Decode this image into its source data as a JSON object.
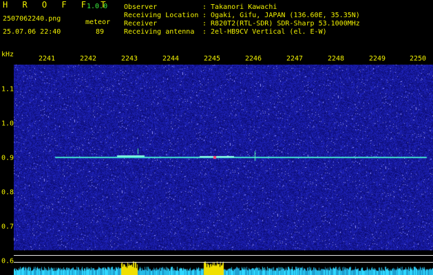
{
  "header": {
    "logo": "H R O F F T",
    "version": "1.0.0",
    "filename": "2507062240.png",
    "datetime": "25.07.06 22:40",
    "mode_label": "meteor",
    "count": "89",
    "fields": [
      {
        "label": "Observer",
        "value": ": Takanori Kawachi"
      },
      {
        "label": "Receiving Location",
        "value": ": Ogaki, Gifu, JAPAN (136.60E, 35.35N)"
      },
      {
        "label": "Receiver",
        "value": ": R820T2(RTL-SDR) SDR-Sharp 53.1000MHz"
      },
      {
        "label": "Receiving antenna",
        "value": ": 2el-HB9CV Vertical (el. E-W)"
      }
    ]
  },
  "axis": {
    "unit": "kHz",
    "time_ticks": [
      "2241",
      "2242",
      "2243",
      "2244",
      "2245",
      "2246",
      "2247",
      "2248",
      "2249",
      "2250"
    ],
    "freq_ticks": [
      "1.1",
      "1.0",
      "0.9",
      "0.8",
      "0.7",
      "0.6"
    ]
  },
  "colors": {
    "text_yellow": "#f2f200",
    "text_green": "#3cf03c",
    "background": "#000000",
    "noise_blue": "#1a1aa8",
    "trace_cyan": "#40e0d0",
    "activity_yellow": "#f0e000",
    "activity_cyan": "#30d8ff"
  }
}
